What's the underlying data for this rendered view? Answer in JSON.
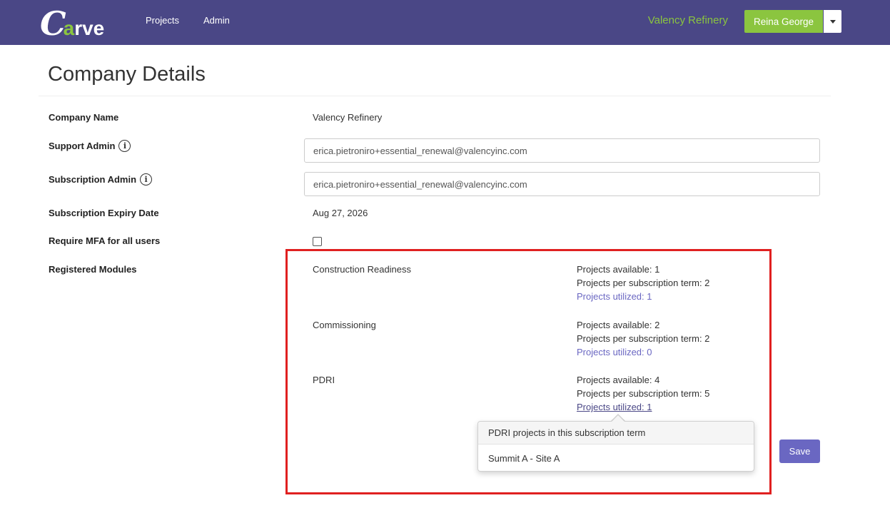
{
  "navbar": {
    "logo": {
      "c": "C",
      "a": "a",
      "rest": "rve"
    },
    "links": [
      "Projects",
      "Admin"
    ],
    "company": "Valency Refinery",
    "user": "Reina George",
    "background": "#4a4786",
    "accent": "#8bc53f"
  },
  "page": {
    "title": "Company Details"
  },
  "form": {
    "company_name_label": "Company Name",
    "company_name_value": "Valency Refinery",
    "support_admin_label": "Support Admin",
    "support_admin_value": "erica.pietroniro+essential_renewal@valencyinc.com",
    "subscription_admin_label": "Subscription Admin",
    "subscription_admin_value": "erica.pietroniro+essential_renewal@valencyinc.com",
    "expiry_label": "Subscription Expiry Date",
    "expiry_value": "Aug 27, 2026",
    "mfa_label": "Require MFA for all users",
    "mfa_checked": false,
    "modules_label": "Registered Modules",
    "info_icon_glyph": "i"
  },
  "modules": [
    {
      "name": "Construction Readiness",
      "available": "Projects available: 1",
      "per_term": "Projects per subscription term: 2",
      "utilized": "Projects utilized: 1"
    },
    {
      "name": "Commissioning",
      "available": "Projects available: 2",
      "per_term": "Projects per subscription term: 2",
      "utilized": "Projects utilized: 0"
    },
    {
      "name": "PDRI",
      "available": "Projects available: 4",
      "per_term": "Projects per subscription term: 5",
      "utilized": "Projects utilized: 1"
    }
  ],
  "popover": {
    "title": "PDRI projects in this subscription term",
    "items": [
      "Summit A - Site A"
    ]
  },
  "actions": {
    "save": "Save",
    "save_color": "#6a67c2"
  },
  "highlight_color": "#e02020"
}
